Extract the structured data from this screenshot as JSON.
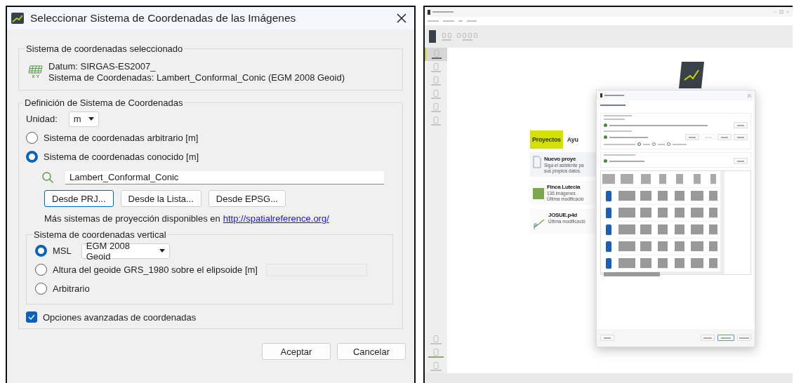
{
  "dialog": {
    "title": "Seleccionar Sistema de Coordenadas de las Imágenes",
    "selected_system": {
      "legend": "Sistema de coordenadas seleccionado",
      "datum": "Datum: SIRGAS-ES2007_",
      "system": "Sistema de Coordenadas: Lambert_Conformal_Conic (EGM 2008 Geoid)"
    },
    "definition": {
      "legend": "Definición de Sistema de Coordenadas",
      "unit_label": "Unidad:",
      "unit_value": "m",
      "options": [
        {
          "label": "Sistema de coordenadas arbitrario [m]",
          "selected": false
        },
        {
          "label": "Sistema de coordenadas conocido [m]",
          "selected": true
        }
      ],
      "search": {
        "value": "Lambert_Conformal_Conic"
      },
      "buttons": [
        {
          "label": "Desde PRJ...",
          "focused": true
        },
        {
          "label": "Desde la Lista...",
          "focused": false
        },
        {
          "label": "Desde EPSG...",
          "focused": false
        }
      ],
      "more_text": "Más sistemas de proyección disponibles en",
      "link": "http://spatialreference.org/",
      "vertical": {
        "legend": "Sistema de coordenadas vertical",
        "options": [
          {
            "kind": "dropdown",
            "label": "MSL",
            "selected": true,
            "value": "EGM 2008 Geoid"
          },
          {
            "kind": "field",
            "label": "Altura del geoide GRS_1980 sobre el elipsoide [m]",
            "selected": false
          },
          {
            "kind": "plain",
            "label": "Arbitrario",
            "selected": false
          }
        ]
      },
      "advanced": {
        "label": "Opciones avanzadas de coordenadas",
        "checked": true
      }
    },
    "buttons": [
      "Aceptar",
      "Cancelar"
    ]
  },
  "screenshot": {
    "sidebar": {
      "items": [
        {
          "selected": true
        },
        {
          "selected": false
        },
        {
          "selected": false
        },
        {
          "selected": false
        },
        {
          "selected": false
        },
        {
          "selected": false
        }
      ]
    },
    "home": {
      "tabs": [
        {
          "label": "Proyectos",
          "selected": true
        },
        {
          "label": "Ayu",
          "selected": false
        }
      ],
      "cards": [
        {
          "kind": "new",
          "title": "Nuevo proye",
          "lines": [
            "Siga el asistente pa",
            "sus propios datos."
          ]
        },
        {
          "kind": "photo",
          "title": "Finca Lutecia",
          "lines": [
            "136 imágenes",
            "Última modificació"
          ]
        },
        {
          "kind": "logo",
          "title": "JOSUE.p4d",
          "lines": [
            "Última modificació"
          ]
        }
      ]
    },
    "project_dialog": {
      "geo_buttons": [
        {
          "disabled": false
        },
        {
          "disabled": true
        },
        {
          "disabled": false
        },
        {
          "disabled": false
        }
      ],
      "accuracy": [
        {
          "selected": true
        },
        {
          "selected": false
        },
        {
          "selected": false
        }
      ],
      "table": {
        "rows": [
          {
            "enabled": true
          },
          {
            "enabled": true
          },
          {
            "enabled": true
          },
          {
            "enabled": true
          },
          {
            "enabled": true
          }
        ]
      }
    }
  }
}
